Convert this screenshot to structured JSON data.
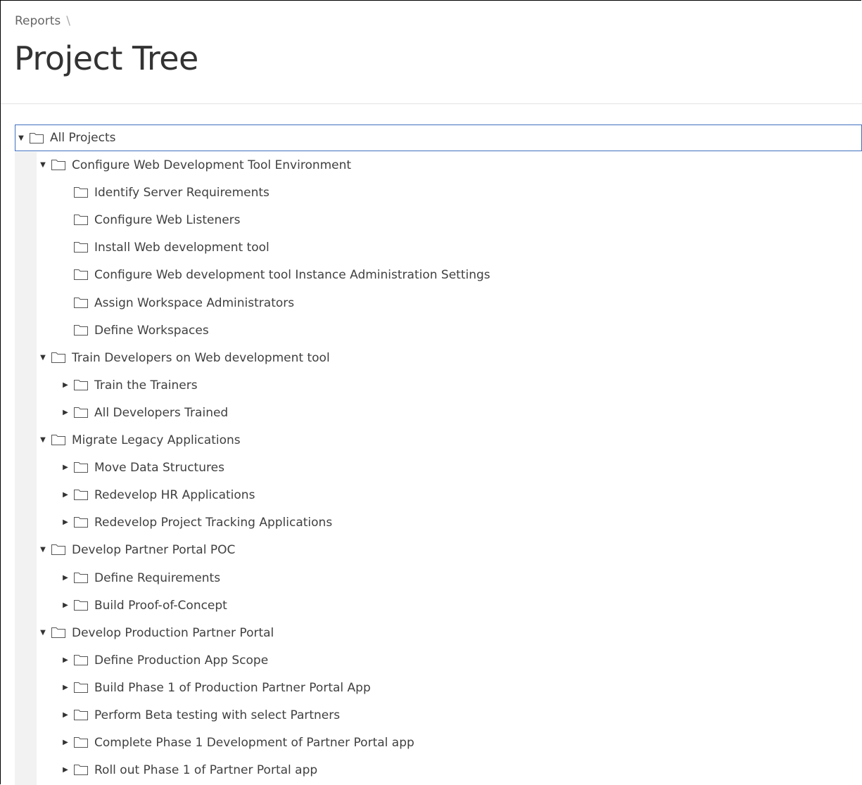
{
  "breadcrumb": {
    "parent": "Reports",
    "separator": "\\"
  },
  "page": {
    "title": "Project Tree"
  },
  "icons": {
    "expanded": "triangle-down-icon",
    "collapsed": "triangle-right-icon",
    "node": "folder-icon"
  },
  "tree": {
    "root": {
      "label": "All Projects",
      "state": "expanded"
    },
    "nodes": [
      {
        "label": "Configure Web Development Tool Environment",
        "level": 1,
        "state": "expanded"
      },
      {
        "label": "Identify Server Requirements",
        "level": 2,
        "state": "leaf"
      },
      {
        "label": "Configure Web Listeners",
        "level": 2,
        "state": "leaf"
      },
      {
        "label": "Install Web development tool",
        "level": 2,
        "state": "leaf"
      },
      {
        "label": "Configure Web development tool Instance Administration Settings",
        "level": 2,
        "state": "leaf"
      },
      {
        "label": "Assign Workspace Administrators",
        "level": 2,
        "state": "leaf"
      },
      {
        "label": "Define Workspaces",
        "level": 2,
        "state": "leaf"
      },
      {
        "label": "Train Developers on Web development tool",
        "level": 1,
        "state": "expanded"
      },
      {
        "label": "Train the Trainers",
        "level": 2,
        "state": "collapsed"
      },
      {
        "label": "All Developers Trained",
        "level": 2,
        "state": "collapsed"
      },
      {
        "label": "Migrate Legacy Applications",
        "level": 1,
        "state": "expanded"
      },
      {
        "label": "Move Data Structures",
        "level": 2,
        "state": "collapsed"
      },
      {
        "label": "Redevelop HR Applications",
        "level": 2,
        "state": "collapsed"
      },
      {
        "label": "Redevelop Project Tracking Applications",
        "level": 2,
        "state": "collapsed"
      },
      {
        "label": "Develop Partner Portal POC",
        "level": 1,
        "state": "expanded"
      },
      {
        "label": "Define Requirements",
        "level": 2,
        "state": "collapsed"
      },
      {
        "label": "Build Proof-of-Concept",
        "level": 2,
        "state": "collapsed"
      },
      {
        "label": "Develop Production Partner Portal",
        "level": 1,
        "state": "expanded"
      },
      {
        "label": "Define Production App Scope",
        "level": 2,
        "state": "collapsed"
      },
      {
        "label": "Build Phase 1 of Production Partner Portal App",
        "level": 2,
        "state": "collapsed"
      },
      {
        "label": "Perform Beta testing with select Partners",
        "level": 2,
        "state": "collapsed"
      },
      {
        "label": "Complete Phase 1 Development of Partner Portal app",
        "level": 2,
        "state": "collapsed"
      },
      {
        "label": "Roll out Phase 1 of Partner Portal app",
        "level": 2,
        "state": "collapsed"
      }
    ]
  }
}
